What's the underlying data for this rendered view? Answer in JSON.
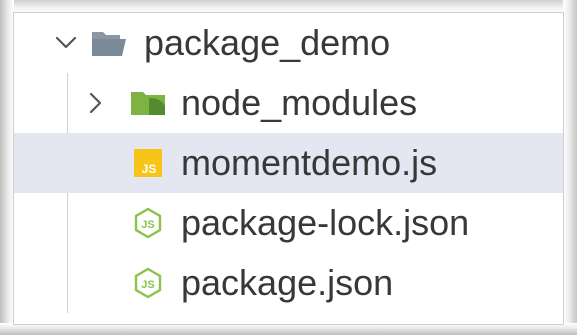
{
  "explorer": {
    "root": {
      "label": "package_demo",
      "expanded": true,
      "icon": "folder-open-icon",
      "icon_color": "#7b8a99"
    },
    "items": [
      {
        "label": "node_modules",
        "type": "folder",
        "expanded": false,
        "icon": "folder-icon",
        "icon_color": "#7cb342"
      },
      {
        "label": "momentdemo.js",
        "type": "file",
        "selected": true,
        "icon": "javascript-file-icon",
        "icon_color": "#f5c518",
        "icon_text": "JS"
      },
      {
        "label": "package-lock.json",
        "type": "file",
        "icon": "nodejs-file-icon",
        "icon_color": "#8bc34a"
      },
      {
        "label": "package.json",
        "type": "file",
        "icon": "nodejs-file-icon",
        "icon_color": "#8bc34a"
      }
    ]
  },
  "colors": {
    "selection": "#e4e6f1",
    "text": "#383838",
    "indent_guide": "#d0d0d0"
  }
}
